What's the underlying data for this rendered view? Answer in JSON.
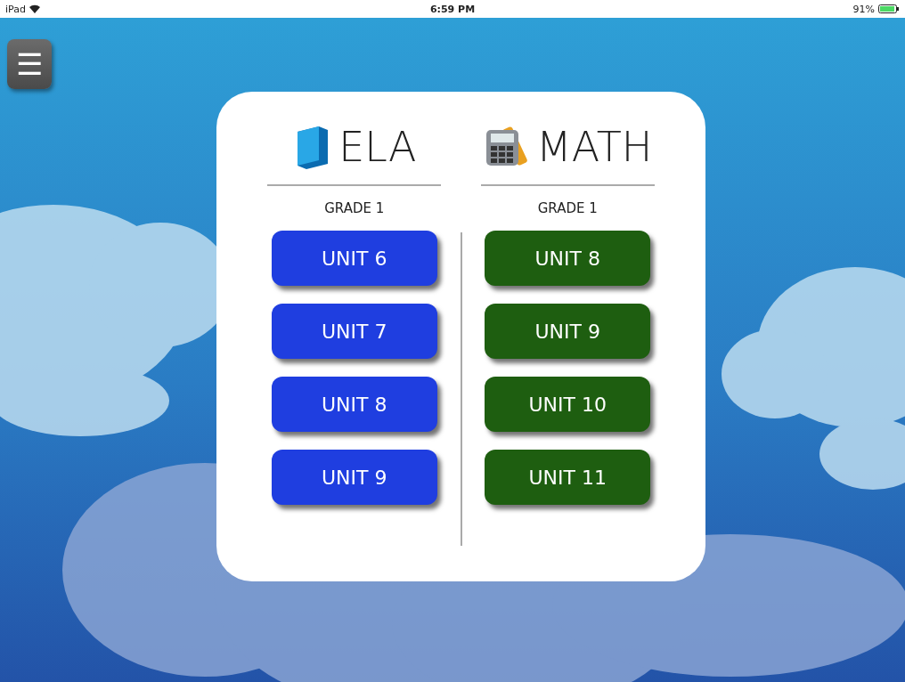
{
  "status_bar": {
    "device": "iPad",
    "time": "6:59 PM",
    "battery": "91%"
  },
  "menu_button": {
    "label": "☰"
  },
  "subjects": [
    {
      "title": "ELA",
      "grade": "GRADE 1",
      "color": "#1f3ee0",
      "units": [
        "UNIT 6",
        "UNIT 7",
        "UNIT 8",
        "UNIT 9"
      ]
    },
    {
      "title": "MATH",
      "grade": "GRADE 1",
      "color": "#1e5e10",
      "units": [
        "UNIT 8",
        "UNIT 9",
        "UNIT 10",
        "UNIT 11"
      ]
    }
  ]
}
